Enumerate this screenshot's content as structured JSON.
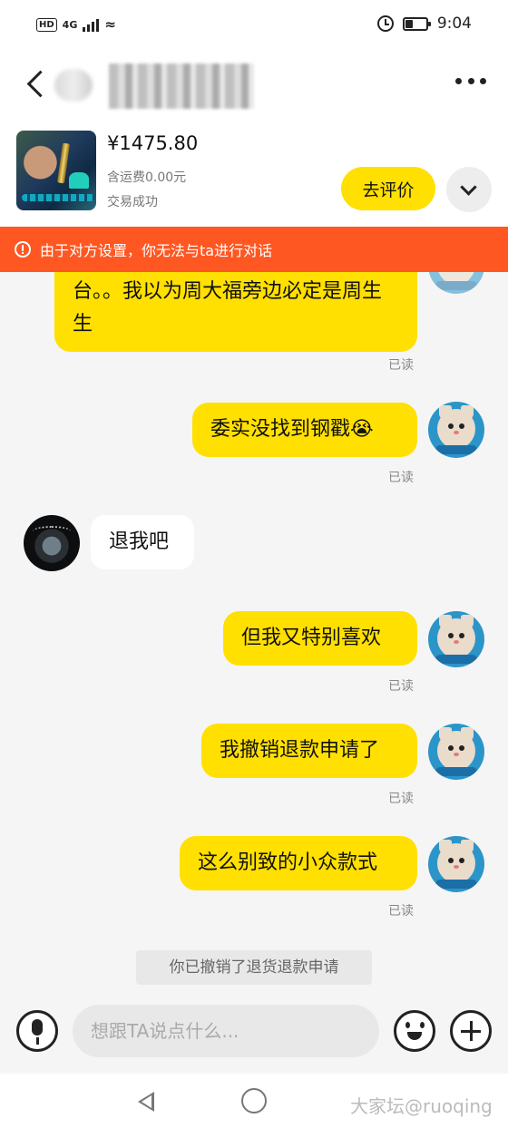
{
  "status_bar": {
    "network": "HD",
    "signal": "4G",
    "time": "9:04",
    "battery_level": 0.35
  },
  "order": {
    "price": "¥1475.80",
    "shipping": "含运费0.00元",
    "trade_status": "交易成功",
    "review_button": "去评价"
  },
  "banner": {
    "text": "由于对方设置，你无法与ta进行对话",
    "color": "#ff5722"
  },
  "messages": [
    {
      "side": "me",
      "text": "台。。我以为周大福旁边必定是周生生",
      "read": "已读"
    },
    {
      "side": "me",
      "text": "委实没找到钢戳😭",
      "read": "已读"
    },
    {
      "side": "other",
      "text": "退我吧"
    },
    {
      "side": "me",
      "text": "但我又特别喜欢",
      "read": "已读"
    },
    {
      "side": "me",
      "text": "我撤销退款申请了",
      "read": "已读"
    },
    {
      "side": "me",
      "text": "这么别致的小众款式",
      "read": "已读"
    }
  ],
  "system_note": "你已撤销了退货退款申请",
  "input": {
    "placeholder": "想跟TA说点什么..."
  },
  "watermark": "大家坛@ruoqing",
  "colors": {
    "accent_yellow": "#ffe000",
    "banner_orange": "#ff5722"
  },
  "icons": [
    "back-icon",
    "more-icon",
    "expand-icon",
    "warning-icon",
    "mic-icon",
    "emoji-icon",
    "plus-icon"
  ]
}
